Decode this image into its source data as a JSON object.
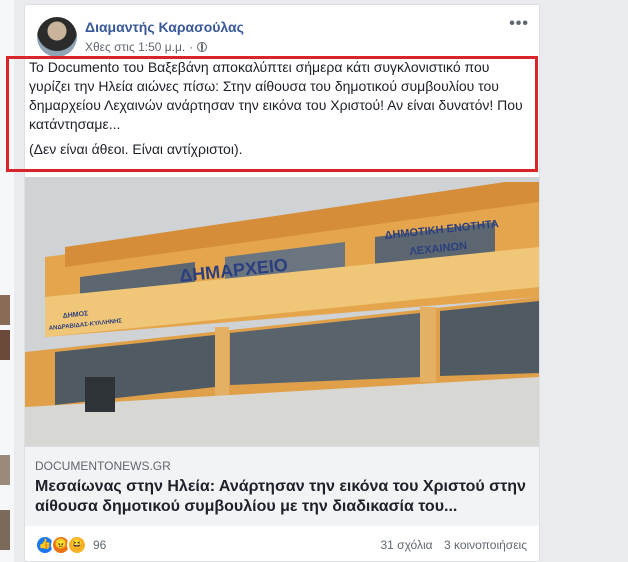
{
  "post": {
    "author": "Διαμαντής Καρασούλας",
    "time": "Χθες στις 1:50 μ.μ.",
    "more_label": "•••",
    "text_lines": [
      "Το Documento του Βαξεβάνη αποκαλύπτει σήμερα κάτι συγκλονιστικό που γυρίζει την Ηλεία αιώνες πίσω: Στην αίθουσα του δημοτικού συμβουλίου του δημαρχείου Λεχαινών ανάρτησαν την εικόνα του Χριστού! Αν είναι δυνατόν! Που κατάντησαμε...",
      "(Δεν είναι άθεοι. Είναι αντίχριστοι)."
    ]
  },
  "link": {
    "image": {
      "sign_main": "ΔΗΜΑΡΧΕΙΟ",
      "sign_right_1": "ΔΗΜΟΤΙΚΗ ΕΝΟΤΗΤΑ",
      "sign_right_2": "ΛΕΧΑΙΝΩΝ",
      "sign_left_1": "ΔΗΜΟΣ",
      "sign_left_2": "ΑΝΔΡΑΒΙΔΑΣ-ΚΥΛΛΗΝΗΣ"
    },
    "domain": "DOCUMENTONEWS.GR",
    "headline": "Μεσαίωνας στην Ηλεία: Ανάρτησαν την εικόνα του Χριστού στην αίθουσα δημοτικού συμβουλίου με την διαδικασία του..."
  },
  "footer": {
    "reaction_icons": [
      "like-icon",
      "angry-icon",
      "haha-icon"
    ],
    "reaction_count": "96",
    "comments": "31 σχόλια",
    "shares": "3 κοινοποιήσεις"
  },
  "colors": {
    "author": "#385898",
    "highlight_border": "#d9252a",
    "like": "#1877f2",
    "angry": "#e9710f",
    "haha": "#f7b125"
  }
}
